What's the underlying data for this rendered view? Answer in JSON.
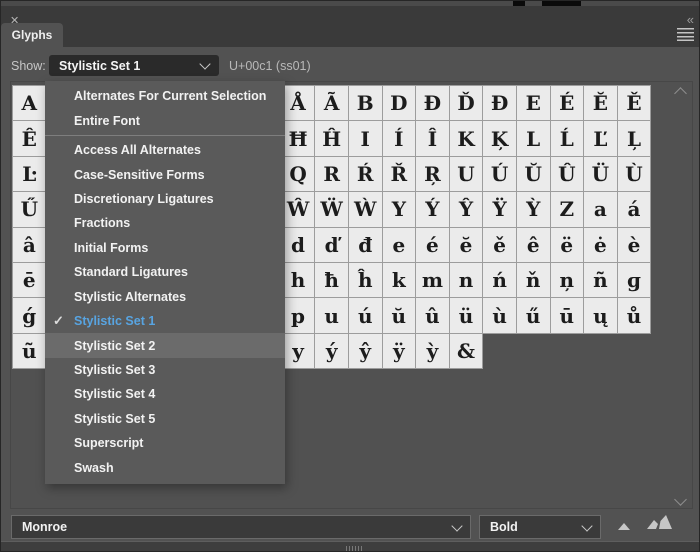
{
  "window": {
    "close_icon": "✕",
    "collapse_icon": "«",
    "panel_menu_icon": "hamburger-4-lines"
  },
  "tab": {
    "label": "Glyphs"
  },
  "toolbar": {
    "show_label": "Show:",
    "show_value": "Stylistic Set 1",
    "unicode_readout": "U+00c1 (ss01)"
  },
  "dropdown_menu": {
    "items": [
      {
        "label": "Alternates For Current Selection"
      },
      {
        "label": "Entire Font",
        "divider_after": true
      },
      {
        "label": "Access All Alternates"
      },
      {
        "label": "Case-Sensitive Forms"
      },
      {
        "label": "Discretionary Ligatures"
      },
      {
        "label": "Fractions"
      },
      {
        "label": "Initial Forms"
      },
      {
        "label": "Standard Ligatures"
      },
      {
        "label": "Stylistic Alternates"
      },
      {
        "label": "Stylistic Set 1",
        "checked": true,
        "selected": true
      },
      {
        "label": "Stylistic Set 2",
        "hover": true
      },
      {
        "label": "Stylistic Set 3"
      },
      {
        "label": "Stylistic Set 4"
      },
      {
        "label": "Stylistic Set 5"
      },
      {
        "label": "Superscript"
      },
      {
        "label": "Swash"
      }
    ]
  },
  "icons": {
    "check": "✓",
    "select_chevron": "chevron-down",
    "scroll_up": "chevron-up",
    "scroll_down": "chevron-down",
    "zoom_out": "small-mountain-triangle",
    "zoom_in": "large-mountain-triangle",
    "resize_grip": "vertical-ridges"
  },
  "glyph_grid": {
    "rows": [
      [
        "A",
        "",
        "",
        "",
        "",
        "",
        "",
        "",
        "Å",
        "Ã",
        "B",
        "D",
        "Đ",
        "Ď",
        "Đ",
        "E",
        "É",
        "Ĕ",
        "Ě"
      ],
      [
        "Ê",
        "",
        "",
        "",
        "",
        "",
        "",
        "",
        "Ħ",
        "Ĥ",
        "I",
        "Í",
        "Î",
        "K",
        "Ķ",
        "L",
        "Ĺ",
        "Ľ",
        "Ļ"
      ],
      [
        "Ŀ",
        "",
        "",
        "",
        "",
        "",
        "",
        "",
        "Q",
        "R",
        "Ŕ",
        "Ř",
        "Ŗ",
        "U",
        "Ú",
        "Ŭ",
        "Û",
        "Ü",
        "Ù"
      ],
      [
        "Ű",
        "",
        "",
        "",
        "",
        "",
        "",
        "",
        "Ŵ",
        "Ẅ",
        "Ẁ",
        "Y",
        "Ý",
        "Ŷ",
        "Ÿ",
        "Ỳ",
        "Z",
        "a",
        "á"
      ],
      [
        "â",
        "",
        "",
        "",
        "",
        "",
        "",
        "",
        "d",
        "ď",
        "đ",
        "e",
        "é",
        "ĕ",
        "ě",
        "ê",
        "ë",
        "ė",
        "è"
      ],
      [
        "ē",
        "",
        "",
        "",
        "",
        "",
        "",
        "",
        "h",
        "ħ",
        "ĥ",
        "k",
        "m",
        "n",
        "ń",
        "ň",
        "ņ",
        "ñ",
        "ɡ"
      ],
      [
        "ǵ",
        "",
        "",
        "",
        "",
        "",
        "",
        "",
        "p",
        "u",
        "ú",
        "ŭ",
        "û",
        "ü",
        "ù",
        "ű",
        "ū",
        "ų",
        "ů"
      ],
      [
        "ũ",
        "",
        "",
        "",
        "",
        "",
        "",
        "",
        "y",
        "ý",
        "ŷ",
        "ÿ",
        "ỳ",
        "&"
      ]
    ]
  },
  "footer": {
    "font_name": "Monroe",
    "font_style": "Bold"
  },
  "colors": {
    "panel_bg": "#525252",
    "chrome_bg": "#3a3a3a",
    "menu_bg": "#5a5a5a",
    "menu_hover_bg": "#6b6b6b",
    "accent_blue": "#58a4e1",
    "cell_bg": "#ebebeb",
    "cell_border": "#9c9c9c",
    "select_bg": "#2a2a2a",
    "field_bg": "#3a3a3a"
  }
}
